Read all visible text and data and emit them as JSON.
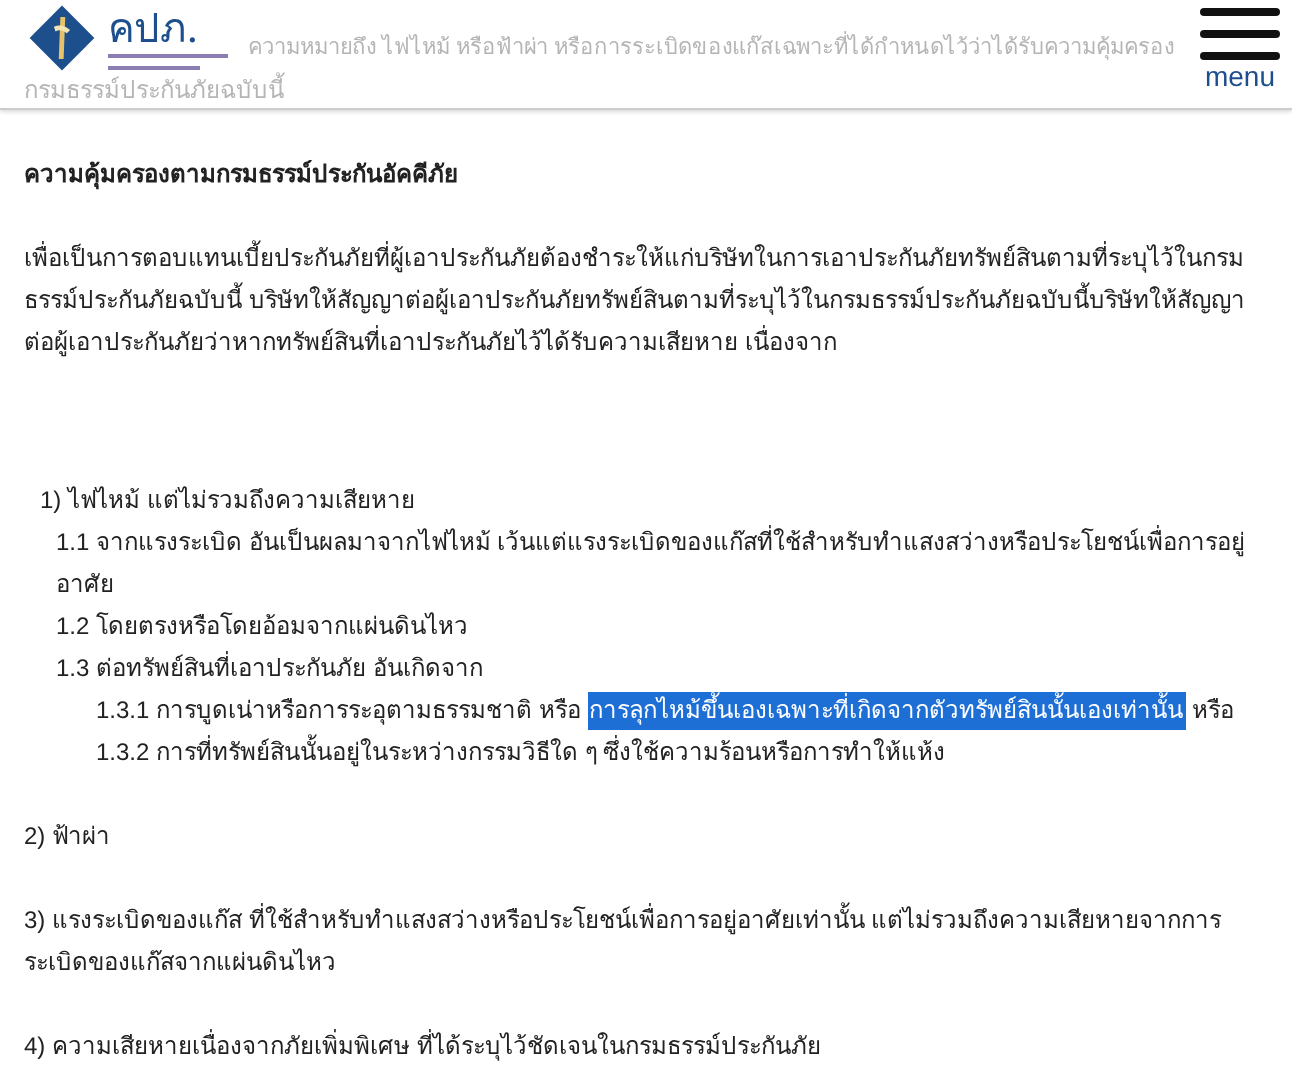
{
  "header": {
    "logo_text": "คปภ.",
    "behind_lines": [
      "ความหมายถึง ไฟไหม้ หรือฟ้าผ่า หรือการระเบิดของแก๊สเฉพาะที่ได้กำหนดไว้ว่าได้รับความคุ้มครอง",
      "กรมธรรม์ประกันภัยฉบับนี้"
    ],
    "menu_label": "menu"
  },
  "heading": "ความคุ้มครองตามกรมธรรม์ประกันอัคคีภัย",
  "intro": "เพื่อเป็นการตอบแทนเบี้ยประกันภัยที่ผู้เอาประกันภัยต้องชำระให้แก่บริษัทในการเอาประกันภัยทรัพย์สินตามที่ระบุไว้ในกรมธรรม์ประกันภัยฉบับนี้ บริษัทให้สัญญาต่อผู้เอาประกันภัยทรัพย์สินตามที่ระบุไว้ในกรมธรรม์ประกันภัยฉบับนี้บริษัทให้สัญญาต่อผู้เอาประกันภัยว่าหากทรัพย์สินที่เอาประกันภัยไว้ได้รับความเสียหาย เนื่องจาก",
  "list": [
    {
      "kind": "item",
      "segments": [
        {
          "text": "1) ไฟไหม้ แต่ไม่รวมถึงความเสียหาย",
          "selected": false
        }
      ],
      "children": [
        {
          "kind": "item",
          "segments": [
            {
              "text": "1.1 จากแรงระเบิด อันเป็นผลมาจากไฟไหม้ เว้นแต่แรงระเบิดของแก๊สที่ใช้สำหรับทำแสงสว่างหรือประโยชน์เพื่อการอยู่อาศัย",
              "selected": false
            }
          ]
        },
        {
          "kind": "item",
          "segments": [
            {
              "text": "1.2 โดยตรงหรือโดยอ้อมจากแผ่นดินไหว",
              "selected": false
            }
          ]
        },
        {
          "kind": "item",
          "segments": [
            {
              "text": "1.3 ต่อทรัพย์สินที่เอาประกันภัย อันเกิดจาก",
              "selected": false
            }
          ],
          "children": [
            {
              "kind": "item",
              "segments": [
                {
                  "text": "1.3.1 การบูดเน่าหรือการระอุตามธรรมชาติ หรือ ",
                  "selected": false
                },
                {
                  "text": "การลุกไหม้ขึ้นเองเฉพาะที่เกิดจากตัวทรัพย์สินนั้นเองเท่านั้น",
                  "selected": true
                },
                {
                  "text": " หรือ",
                  "selected": false
                }
              ]
            },
            {
              "kind": "item",
              "segments": [
                {
                  "text": "1.3.2 การที่ทรัพย์สินนั้นอยู่ในระหว่างกรรมวิธีใด ๆ ซึ่งใช้ความร้อนหรือการทำให้แห้ง",
                  "selected": false
                }
              ]
            }
          ]
        }
      ]
    },
    {
      "kind": "para",
      "segments": [
        {
          "text": "2) ฟ้าผ่า",
          "selected": false
        }
      ]
    },
    {
      "kind": "para",
      "segments": [
        {
          "text": "3) แรงระเบิดของแก๊ส ที่ใช้สำหรับทำแสงสว่างหรือประโยชน์เพื่อการอยู่อาศัยเท่านั้น แต่ไม่รวมถึงความเสียหายจากการระเบิดของแก๊สจากแผ่นดินไหว",
          "selected": false
        }
      ]
    },
    {
      "kind": "para",
      "segments": [
        {
          "text": "4) ความเสียหายเนื่องจากภัยเพิ่มพิเศษ ที่ได้ระบุไว้ชัดเจนในกรมธรรม์ประกันภัย",
          "selected": false
        }
      ]
    }
  ]
}
